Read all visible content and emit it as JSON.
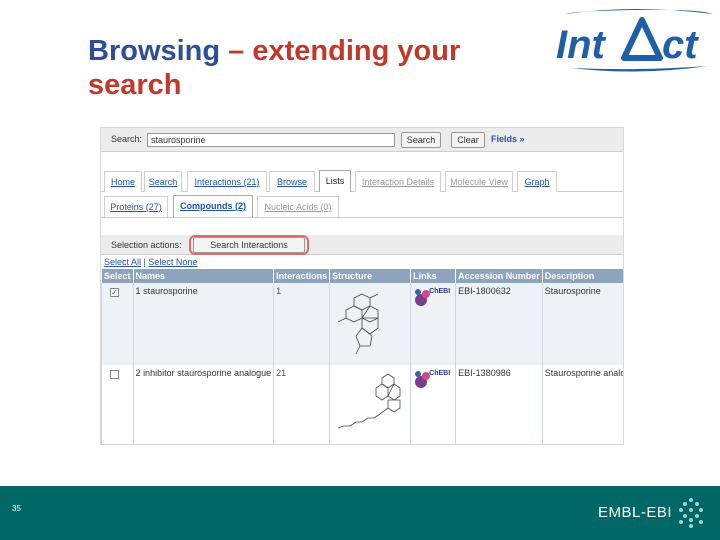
{
  "slide": {
    "title_part1": "Browsing",
    "title_dash": " – extending your search",
    "page_number": "35",
    "footer_brand": "EMBL-EBI",
    "logo_text": "IntAct"
  },
  "search": {
    "label": "Search:",
    "value": "staurosporine",
    "search_button": "Search",
    "clear_button": "Clear",
    "fields_link": "Fields »"
  },
  "tabs": [
    {
      "label": "Home",
      "state": "link"
    },
    {
      "label": "Search",
      "state": "link"
    },
    {
      "label": "Interactions (21)",
      "state": "link"
    },
    {
      "label": "Browse",
      "state": "link"
    },
    {
      "label": "Lists",
      "state": "active"
    },
    {
      "label": "Interaction Details",
      "state": "disabled"
    },
    {
      "label": "Molecule View",
      "state": "disabled"
    },
    {
      "label": "Graph",
      "state": "link"
    }
  ],
  "subtabs": [
    {
      "label": "Proteins (27)",
      "state": "link"
    },
    {
      "label": "Compounds (2)",
      "state": "active"
    },
    {
      "label": "Nucleic Acids (0)",
      "state": "disabled"
    }
  ],
  "selection": {
    "label": "Selection actions:",
    "button": "Search Interactions",
    "select_all": "Select All",
    "separator": " | ",
    "select_none": "Select None"
  },
  "table": {
    "headers": [
      "Select",
      "Names",
      "Interactions",
      "Structure",
      "Links",
      "Accession Number",
      "Description"
    ],
    "rows": [
      {
        "checked": true,
        "index": "1",
        "name": "staurosporine",
        "interactions": "1",
        "link": "ChEBI",
        "accession": "EBI-1800632",
        "description": "Staurosporine"
      },
      {
        "checked": false,
        "index": "2",
        "name": "inhibitor staurosporine analogue",
        "interactions": "21",
        "link": "ChEBI",
        "accession": "EBI-1380986",
        "description": "Staurosporine analogue"
      }
    ]
  },
  "colors": {
    "title_blue": "#2e4f95",
    "title_red": "#c0392b",
    "footer_teal": "#006666",
    "header_row": "#8ea3bd"
  }
}
